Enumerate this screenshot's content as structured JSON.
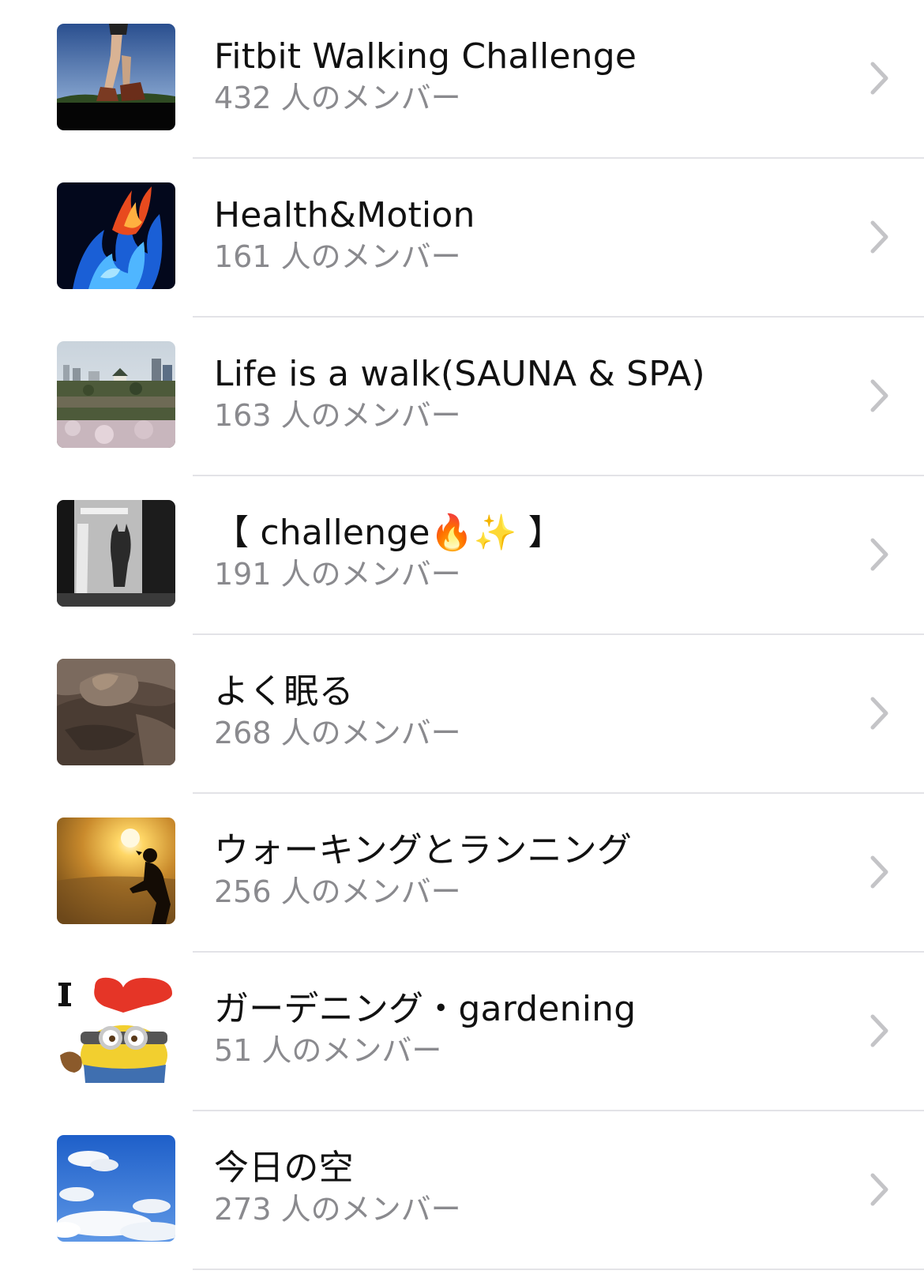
{
  "groups": [
    {
      "name": "Fitbit Walking Challenge",
      "members": "432 人のメンバー",
      "thumbnail_icon": "walking-feet-icon"
    },
    {
      "name": "Health&Motion",
      "members": "161 人のメンバー",
      "thumbnail_icon": "blue-fire-icon"
    },
    {
      "name": "Life is a walk(SAUNA & SPA)",
      "members": "163 人のメンバー",
      "thumbnail_icon": "city-castle-icon"
    },
    {
      "name": "【 challenge🔥✨ 】",
      "members": "191 人のメンバー",
      "thumbnail_icon": "cat-window-icon"
    },
    {
      "name": "よく眠る",
      "members": "268 人のメンバー",
      "thumbnail_icon": "sleeping-cat-icon"
    },
    {
      "name": "ウォーキングとランニング",
      "members": "256 人のメンバー",
      "thumbnail_icon": "runner-sunset-icon"
    },
    {
      "name": "ガーデニング・gardening",
      "members": "51 人のメンバー",
      "thumbnail_icon": "minion-heart-icon"
    },
    {
      "name": "今日の空",
      "members": "273 人のメンバー",
      "thumbnail_icon": "sky-clouds-icon"
    }
  ],
  "colors": {
    "title": "#111111",
    "subtitle": "#8a8a8e",
    "divider": "#e3e3e7",
    "chevron": "#c4c4c7"
  }
}
